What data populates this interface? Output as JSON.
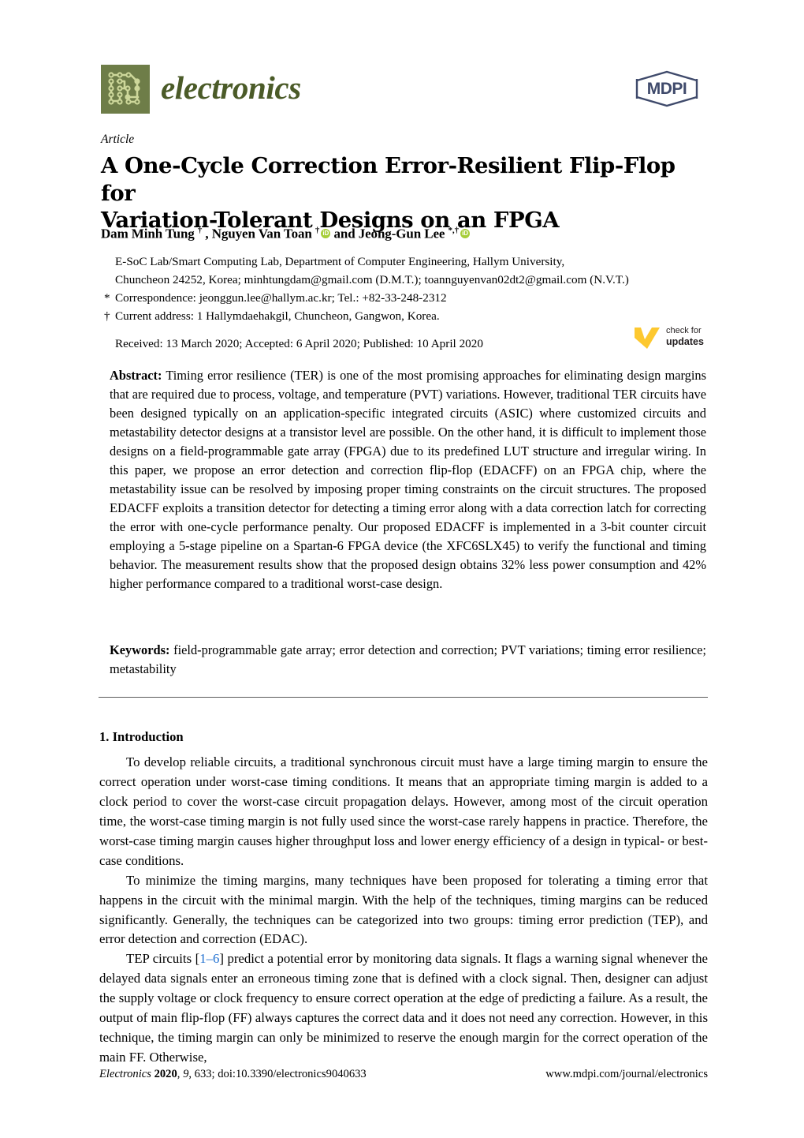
{
  "journal": {
    "name": "electronics",
    "logo_icon": "circuit-board-icon",
    "logo_color": "#6e7d48",
    "wordmark_color": "#4b5b28",
    "publisher_logo": "mdpi-logo",
    "publisher_name": "MDPI",
    "publisher_color": "#3f4a6b"
  },
  "article": {
    "type": "Article",
    "title": "A One-Cycle Correction Error-Resilient Flip-Flop for Variation-Tolerant Designs on an FPGA",
    "title_line1": "A One-Cycle Correction Error-Resilient Flip-Flop for",
    "title_line2": "Variation-Tolerant Designs on an FPGA"
  },
  "authors": {
    "line_parts": [
      {
        "text": "Dam Minh Tung ",
        "type": "name"
      },
      {
        "text": "†",
        "type": "sup"
      },
      {
        "text": " , Nguyen Van Toan ",
        "type": "name"
      },
      {
        "text": "†",
        "type": "sup"
      },
      {
        "text": "iD",
        "type": "orcid"
      },
      {
        "text": " and Jeong-Gun Lee ",
        "type": "name"
      },
      {
        "text": "*,†",
        "type": "sup"
      },
      {
        "text": "iD",
        "type": "orcid"
      }
    ],
    "plain": "Dam Minh Tung † , Nguyen Van Toan † and Jeong-Gun Lee *,†",
    "orcid_color": "#a6ce39"
  },
  "affiliations": {
    "line1": "E-SoC Lab/Smart Computing Lab, Department of Computer Engineering, Hallym University,",
    "line2": "Chuncheon 24252, Korea; minhtungdam@gmail.com (D.M.T.); toannguyenvan02dt2@gmail.com (N.V.T.)",
    "correspondence_marker": "*",
    "correspondence": "Correspondence: jeonggun.lee@hallym.ac.kr; Tel.: +82-33-248-2312",
    "current_address_marker": "†",
    "current_address": "Current address: 1 Hallymdaehakgil, Chuncheon, Gangwon, Korea."
  },
  "dates": {
    "line": "Received: 13 March 2020; Accepted: 6 April 2020; Published: 10 April 2020",
    "received": "13 March 2020",
    "accepted": "6 April 2020",
    "published": "10 April 2020"
  },
  "crossmark": {
    "icon": "check-mark-icon",
    "color": "#fdc82f",
    "line1": "check for",
    "line2": "updates"
  },
  "abstract": {
    "label": "Abstract:",
    "text": "Timing error resilience (TER) is one of the most promising approaches for eliminating design margins that are required due to process, voltage, and temperature (PVT) variations. However, traditional TER circuits have been designed typically on an application-specific integrated circuits (ASIC) where customized circuits and metastability detector designs at a transistor level are possible. On the other hand, it is difficult to implement those designs on a field-programmable gate array (FPGA) due to its predefined LUT structure and irregular wiring. In this paper, we propose an error detection and correction flip-flop (EDACFF) on an FPGA chip, where the metastability issue can be resolved by imposing proper timing constraints on the circuit structures. The proposed EDACFF exploits a transition detector for detecting a timing error along with a data correction latch for correcting the error with one-cycle performance penalty. Our proposed EDACFF is implemented in a 3-bit counter circuit employing a 5-stage pipeline on a Spartan-6 FPGA device (the XFC6SLX45) to verify the functional and timing behavior. The measurement results show that the proposed design obtains 32% less power consumption and 42% higher performance compared to a traditional worst-case design."
  },
  "keywords": {
    "label": "Keywords:",
    "text": "field-programmable gate array; error detection and correction; PVT variations; timing error resilience; metastability"
  },
  "body": {
    "section_number_title": "1. Introduction",
    "paragraphs": [
      "To develop reliable circuits, a traditional synchronous circuit must have a large timing margin to ensure the correct operation under worst-case timing conditions. It means that an appropriate timing margin is added to a clock period to cover the worst-case circuit propagation delays. However, among  most of the circuit operation time, the worst-case timing margin is not fully used since the worst-case rarely happens in practice. Therefore, the worst-case timing margin causes higher throughput loss and lower energy efficiency of a design in typical- or best-case conditions.",
      "To minimize the timing margins, many techniques have been proposed for tolerating a timing error that happens in the circuit with the minimal margin. With the help of the techniques, timing margins can be reduced significantly. Generally, the techniques can be categorized into two groups: timing error prediction (TEP), and error detection and correction (EDAC)."
    ],
    "paragraph3_pre": "TEP circuits [",
    "paragraph3_citation": "1–6",
    "paragraph3_post": "] predict a potential error by monitoring data signals. It flags a warning signal whenever the delayed data signals enter an erroneous timing zone that is defined with a clock signal. Then, designer can adjust the supply voltage or clock frequency to ensure correct operation at the edge of predicting a failure. As a result, the output of main flip-flop (FF) always captures the correct data and it does not need any correction. However, in this technique, the timing margin can only be minimized to reserve the enough margin for the correct operation of the main FF. Otherwise,",
    "citation_color": "#1f6fd0"
  },
  "footer": {
    "journal_italic": "Electronics",
    "year": "2020",
    "volume": "9",
    "article_no": "633",
    "doi": "doi:10.3390/electronics9040633",
    "left_full": "Electronics 2020, 9, 633; doi:10.3390/electronics9040633",
    "right": "www.mdpi.com/journal/electronics"
  }
}
